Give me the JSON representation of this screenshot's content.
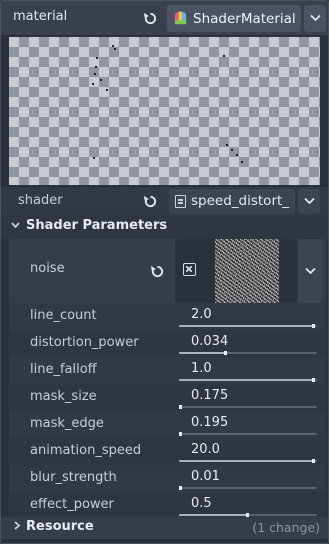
{
  "header": {
    "label": "material",
    "resource_type": "ShaderMaterial"
  },
  "shader": {
    "label": "shader",
    "file": "speed_distort_"
  },
  "section": {
    "title": "Shader Parameters"
  },
  "noise": {
    "label": "noise"
  },
  "params": [
    {
      "name": "line_count",
      "value": "2.0",
      "level": 0.98
    },
    {
      "name": "distortion_power",
      "value": "0.034",
      "level": 0.34
    },
    {
      "name": "line_falloff",
      "value": "1.0",
      "level": 0.98
    },
    {
      "name": "mask_size",
      "value": "0.175",
      "level": 0.0
    },
    {
      "name": "mask_edge",
      "value": "0.195",
      "level": 0.0
    },
    {
      "name": "animation_speed",
      "value": "20.0",
      "level": 0.98
    },
    {
      "name": "blur_strength",
      "value": "0.01",
      "level": 0.0
    },
    {
      "name": "effect_power",
      "value": "0.5",
      "level": 0.5
    }
  ],
  "footer": {
    "title": "Resource",
    "changes": "(1 change)"
  },
  "icons": {
    "revert": "revert-icon",
    "shader_material": "shader-material-icon",
    "file": "shader-file-icon",
    "noise_texture": "noise-texture-icon",
    "dropdown": "chevron-down-icon"
  },
  "colors": {
    "panel": "#2b313c",
    "row": "#363d4a",
    "button": "#4a5263",
    "text": "#d6dbe3"
  }
}
